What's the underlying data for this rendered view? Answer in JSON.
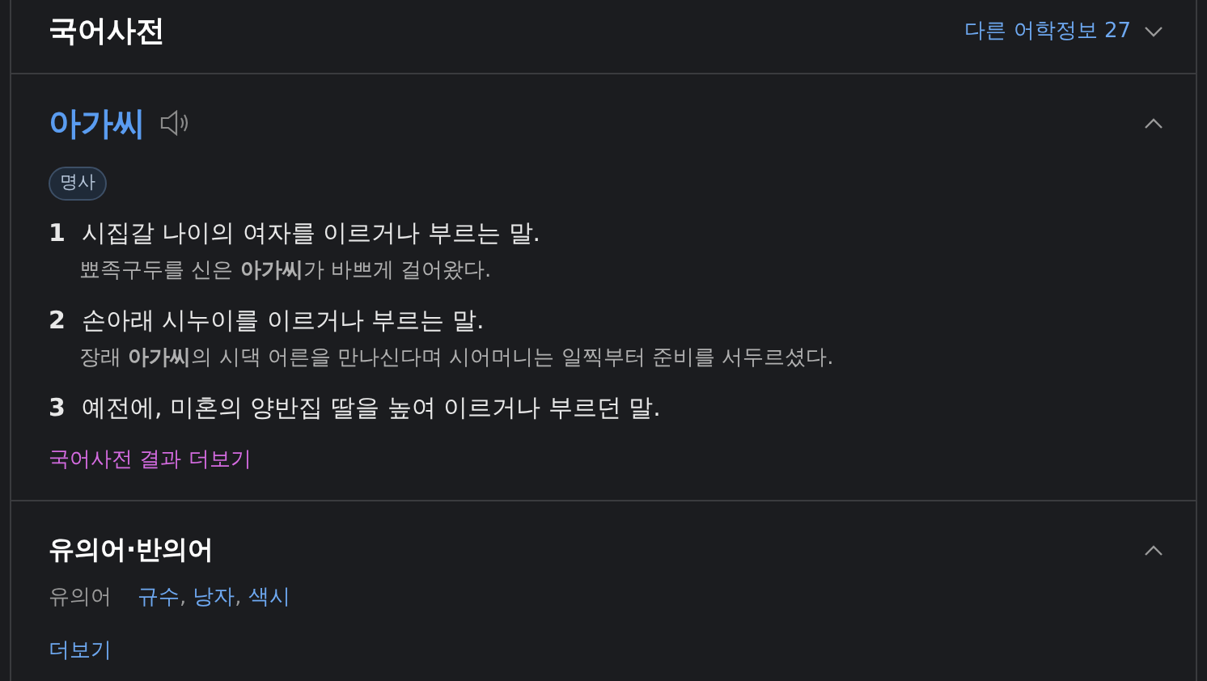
{
  "header": {
    "title": "국어사전",
    "more_info": "다른 어학정보 27"
  },
  "entry": {
    "word": "아가씨",
    "expanded": true,
    "part_of_speech": "명사",
    "senses": [
      {
        "number": "1",
        "definition": "시집갈 나이의 여자를 이르거나 부르는 말.",
        "example": "뾰족구두를 신은 **아가씨**가 바쁘게 걸어왔다."
      },
      {
        "number": "2",
        "definition": "손아래 시누이를 이르거나 부르는 말.",
        "example": "장래 **아가씨**의 시댁 어른을 만나신다며 시어머니는 일찍부터 준비를 서두르셨다."
      },
      {
        "number": "3",
        "definition": "예전에, 미혼의 양반집 딸을 높여 이르거나 부르던 말."
      }
    ],
    "more_link": "국어사전 결과 더보기"
  },
  "synonyms": {
    "title": "유의어·반의어",
    "expanded": true,
    "label": "유의어",
    "separator": ",",
    "words": [
      "규수",
      "낭자",
      "색시"
    ],
    "more_link": "더보기"
  }
}
